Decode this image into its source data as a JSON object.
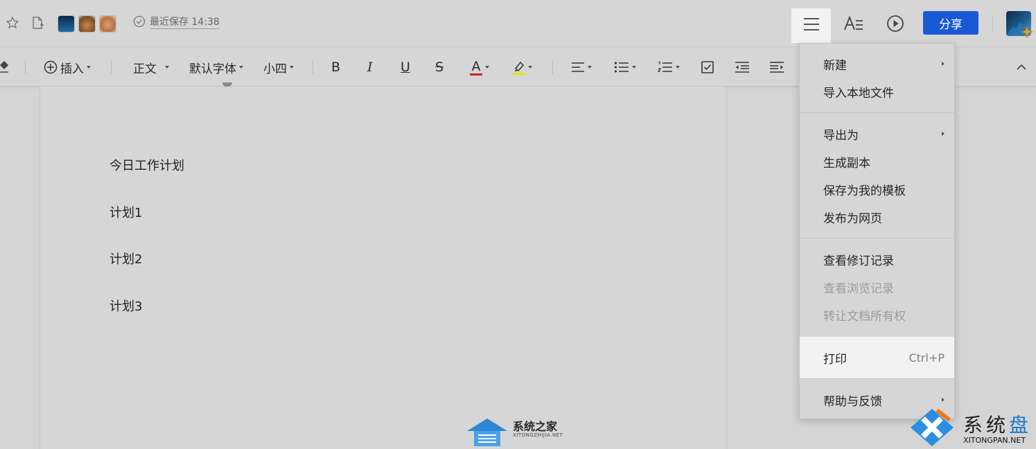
{
  "header": {
    "save_status": "最近保存 14:38",
    "share_label": "分享",
    "icons": [
      "star-icon",
      "add-document-icon",
      "menu-icon",
      "font-format-icon",
      "play-icon"
    ]
  },
  "toolbar": {
    "insert_label": "插入",
    "style_label": "正文",
    "font_label": "默认字体",
    "size_label": "小四",
    "bold": "B",
    "italic": "I",
    "underline": "U",
    "strike": "S",
    "font_color_glyph": "A",
    "font_color": "#d61f1f",
    "highlight_color": "#e6e600"
  },
  "document": {
    "lines": [
      "今日工作计划",
      "计划1",
      "计划2",
      "计划3"
    ]
  },
  "menu": {
    "items": [
      {
        "label": "新建",
        "submenu": true
      },
      {
        "label": "导入本地文件"
      },
      {
        "label": "导出为",
        "submenu": true
      },
      {
        "label": "生成副本"
      },
      {
        "label": "保存为我的模板"
      },
      {
        "label": "发布为网页"
      },
      {
        "label": "查看修订记录"
      },
      {
        "label": "查看浏览记录",
        "disabled": true
      },
      {
        "label": "转让文档所有权",
        "disabled": true
      },
      {
        "label": "打印",
        "shortcut": "Ctrl+P",
        "highlighted": true
      },
      {
        "label": "帮助与反馈",
        "submenu": true
      }
    ]
  },
  "watermarks": {
    "center_title": "系统之家",
    "center_sub": "XITONGZHIJIA.NET",
    "corner_title_a": "系统",
    "corner_title_b": "盘",
    "corner_sub": "XITONGPAN.NET"
  },
  "colors": {
    "accent": "#1a59d6",
    "background": "#d6d6d6"
  }
}
